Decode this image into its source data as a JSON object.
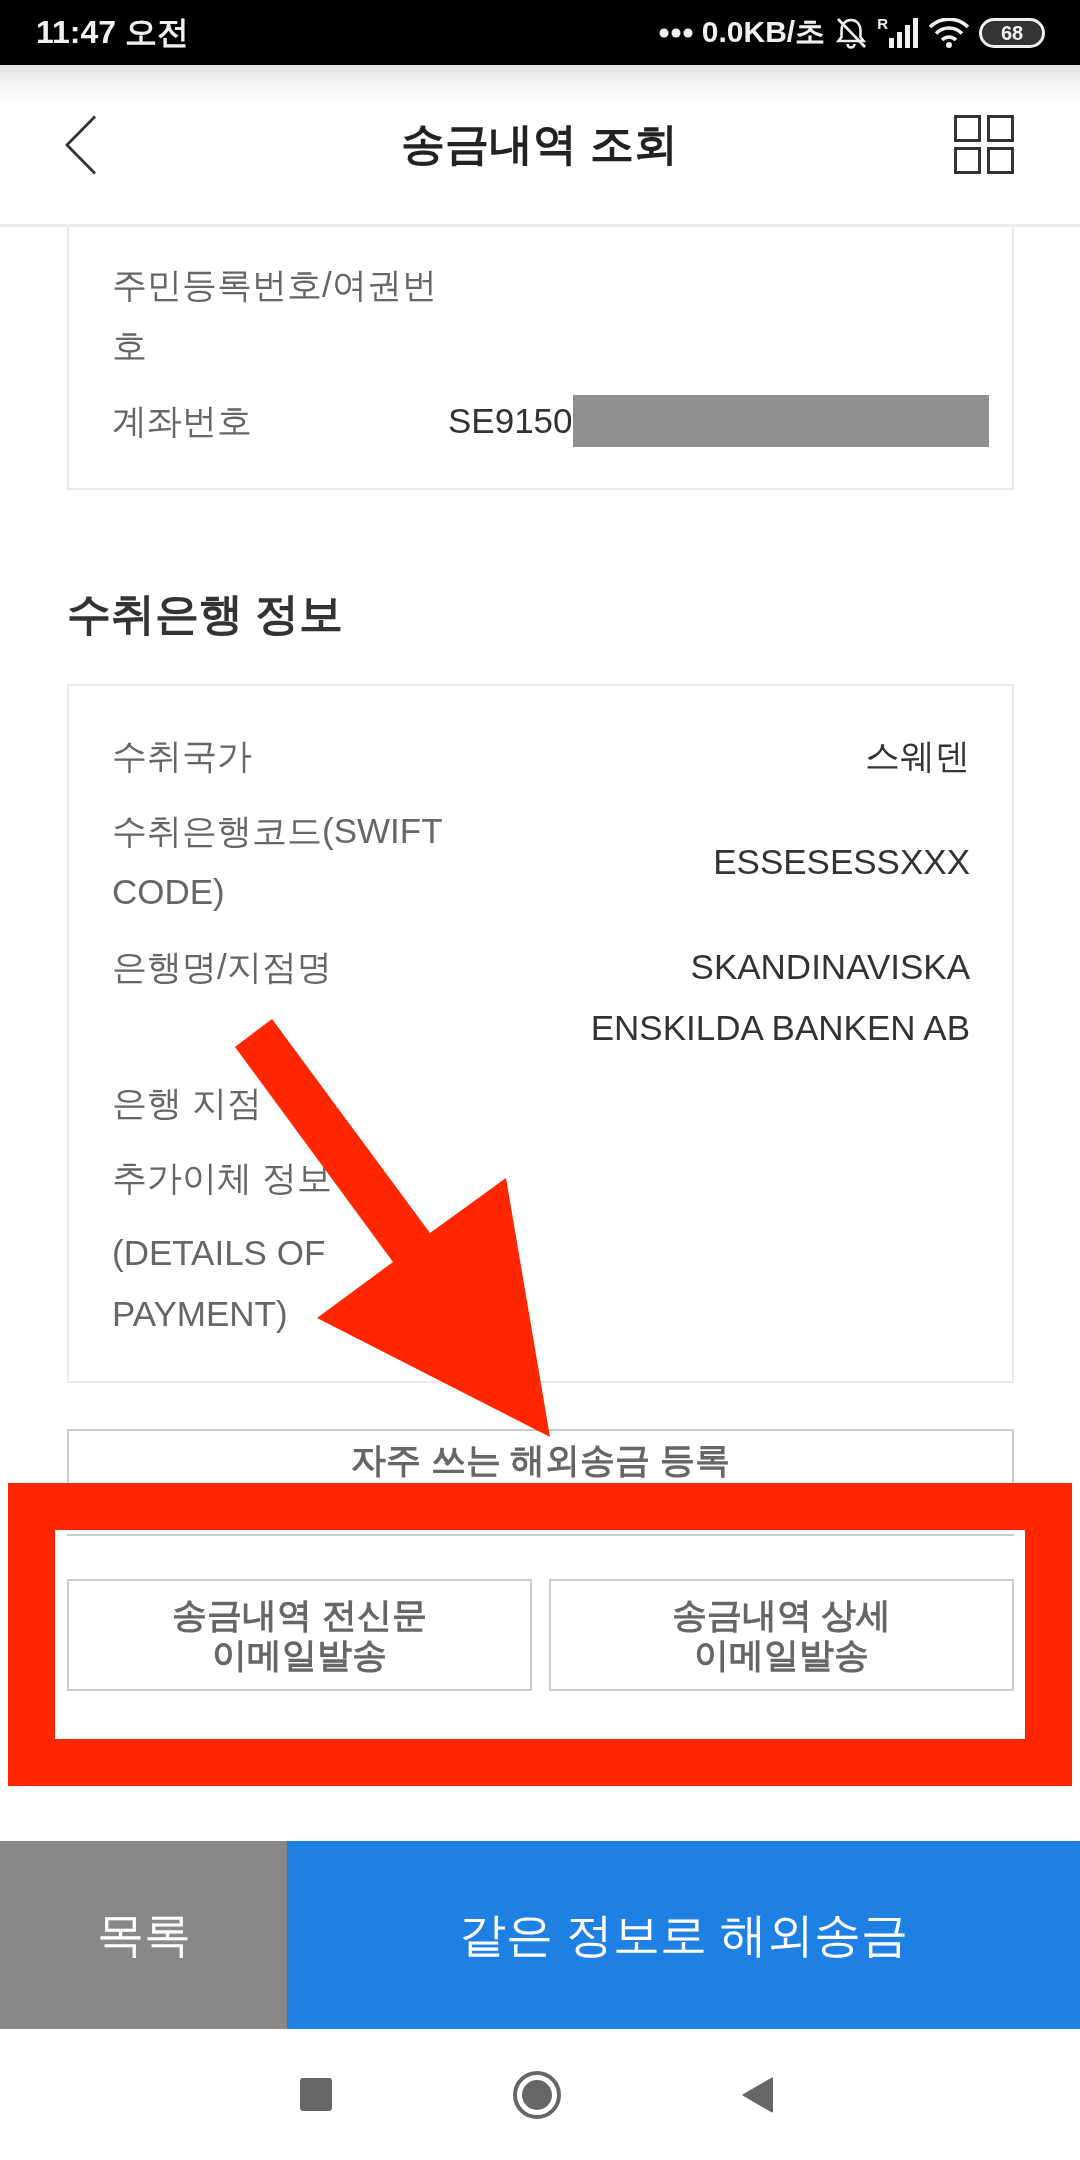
{
  "status_bar": {
    "time": "11:47 오전",
    "network_speed": "0.0KB/초",
    "roaming": "R",
    "battery": "68"
  },
  "header": {
    "title": "송금내역 조회"
  },
  "sender_card": {
    "rows": [
      {
        "label": "주민등록번호/여권번호",
        "redacted": false
      },
      {
        "label": "계좌번호",
        "value": "SE9150",
        "redacted": true
      }
    ]
  },
  "bank_section": {
    "heading": "수취은행 정보",
    "rows": [
      {
        "label": "수취국가",
        "value": "스웨덴"
      },
      {
        "label": "수취은행코드(SWIFT CODE)",
        "value": "ESSESESSXXX"
      },
      {
        "label": "은행명/지점명",
        "value": "SKANDINAVISKA ENSKILDA BANKEN AB"
      },
      {
        "label": "은행 지점"
      },
      {
        "label": "추가이체 정보"
      },
      {
        "label": "(DETAILS OF PAYMENT)"
      }
    ]
  },
  "register_button": "자주 쓰는 해외송금 등록",
  "email_buttons": [
    "송금내역 전신문 이메일발송",
    "송금내역 상세 이메일발송"
  ],
  "bottom_bar": {
    "list_button": "목록",
    "remit_button": "같은 정보로 해외송금"
  },
  "annotations": {
    "arrow": true,
    "highlight_frame": true
  }
}
